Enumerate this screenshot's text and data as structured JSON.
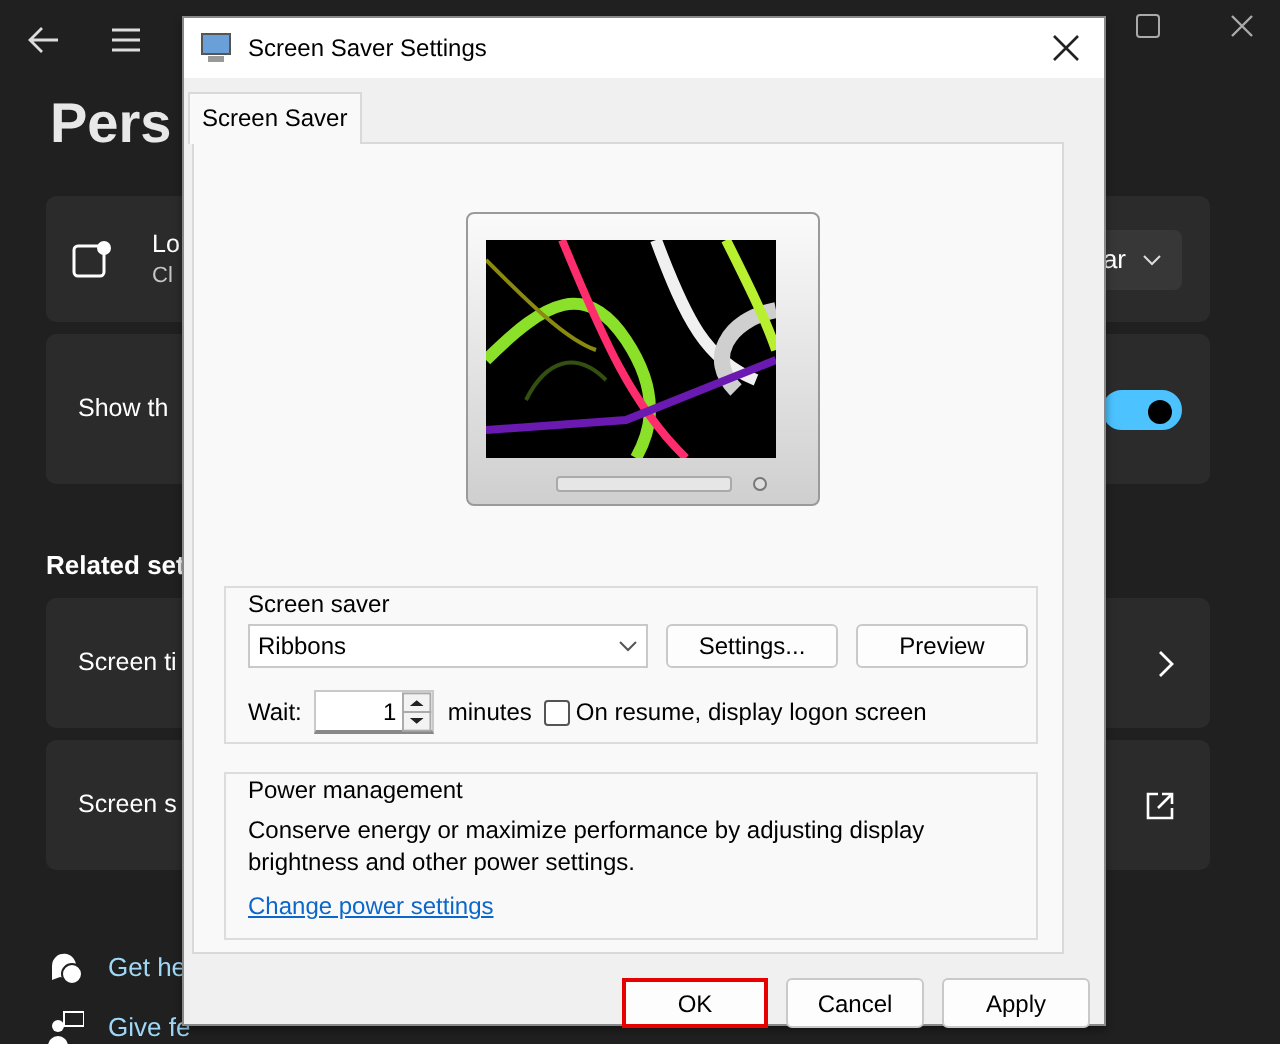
{
  "background": {
    "title": "Pers",
    "cards": [
      {
        "kind": "dropdown",
        "title": "Lo",
        "subtitle": "Cl",
        "value": "ar"
      },
      {
        "kind": "toggle",
        "title": "Show th",
        "on": true
      }
    ],
    "related_heading": "Related set",
    "related": [
      {
        "kind": "chevron",
        "title": "Screen ti"
      },
      {
        "kind": "external",
        "title": "Screen s"
      }
    ],
    "links": [
      {
        "kind": "help",
        "label": "Get he"
      },
      {
        "kind": "feedback",
        "label": "Give fe"
      }
    ]
  },
  "dialog": {
    "title": "Screen Saver Settings",
    "tabs": [
      {
        "label": "Screen Saver",
        "selected": true
      }
    ],
    "screen_saver": {
      "heading": "Screen saver",
      "selection": "Ribbons",
      "buttons": [
        "Settings...",
        "Preview"
      ],
      "wait_label": "Wait:",
      "wait_value": "1",
      "unit": "minutes",
      "logon": {
        "label": "On resume, display logon screen",
        "checked": false
      }
    },
    "power": {
      "heading": "Power management",
      "description": "Conserve energy or maximize performance by adjusting display brightness and other power settings.",
      "link": "Change power settings"
    },
    "buttons": [
      {
        "label": "OK",
        "highlighted": true
      },
      {
        "label": "Cancel",
        "highlighted": false
      },
      {
        "label": "Apply",
        "highlighted": false
      }
    ]
  }
}
